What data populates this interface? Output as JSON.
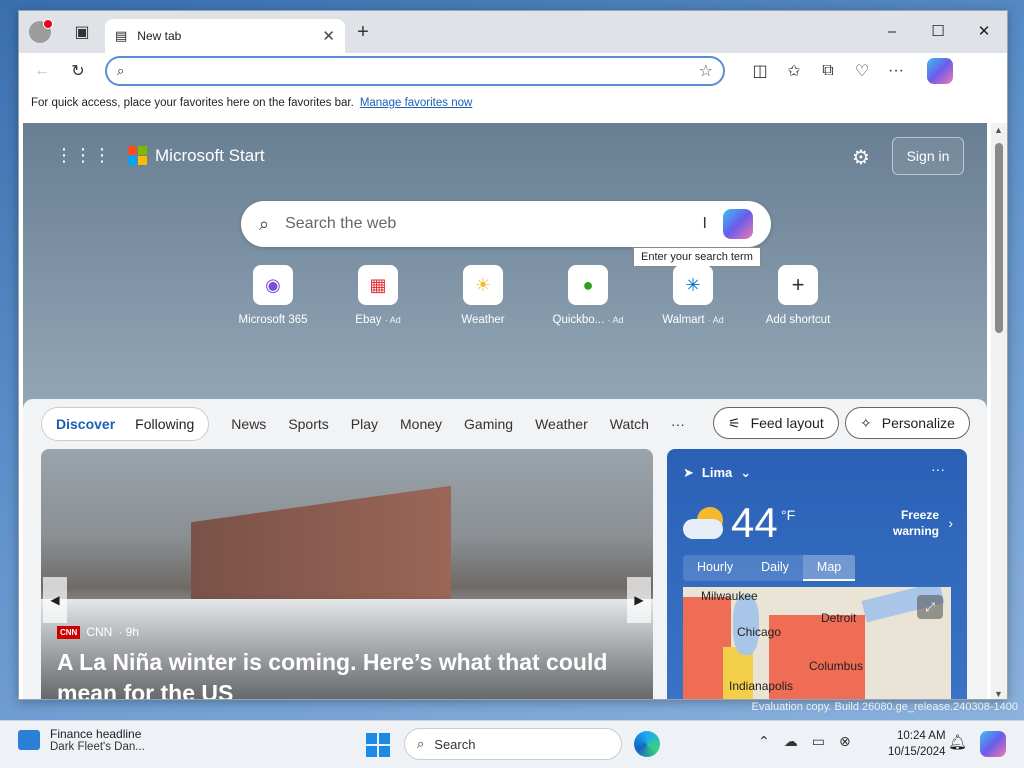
{
  "browser": {
    "tab_title": "New tab",
    "window_controls": [
      "–",
      "☐",
      "✕"
    ],
    "address_value": "",
    "favorites_bar": {
      "text": "For quick access, place your favorites here on the favorites bar.",
      "link": "Manage favorites now"
    }
  },
  "page": {
    "brand": "Microsoft Start",
    "signin": "Sign in",
    "search_placeholder": "Search the web",
    "tooltip": "Enter your search term",
    "shortcuts": [
      {
        "label": "Microsoft 365",
        "ad": ""
      },
      {
        "label": "Ebay",
        "ad": "· Ad"
      },
      {
        "label": "Weather",
        "ad": ""
      },
      {
        "label": "Quickbo...",
        "ad": "· Ad"
      },
      {
        "label": "Walmart",
        "ad": "· Ad"
      },
      {
        "label": "Add shortcut",
        "ad": ""
      }
    ],
    "feed": {
      "tabs": [
        "Discover",
        "Following"
      ],
      "categories": [
        "News",
        "Sports",
        "Play",
        "Money",
        "Gaming",
        "Weather",
        "Watch",
        "···"
      ],
      "feed_layout": "Feed layout",
      "personalize": "Personalize",
      "hero": {
        "source": "CNN",
        "age": "· 9h",
        "headline": "A La Niña winter is coming. Here’s what that could mean for the US"
      }
    },
    "weather": {
      "location": "Lima",
      "temp": "44",
      "unit": "°F",
      "alert_line1": "Freeze",
      "alert_line2": "warning",
      "tabs": [
        "Hourly",
        "Daily",
        "Map"
      ],
      "cities": [
        "Milwaukee",
        "Detroit",
        "Chicago",
        "Columbus",
        "Indianapolis"
      ]
    }
  },
  "taskbar": {
    "news_title": "Finance headline",
    "news_sub": "Dark Fleet's Dan...",
    "search": "Search",
    "time": "10:24 AM",
    "date": "10/15/2024"
  },
  "watermark": "Evaluation copy. Build 26080.ge_release.240308-1400",
  "colors": {
    "accent": "#1a5fb4",
    "weather_bg": "#2a61b6",
    "alert_red": "#e8001b"
  }
}
